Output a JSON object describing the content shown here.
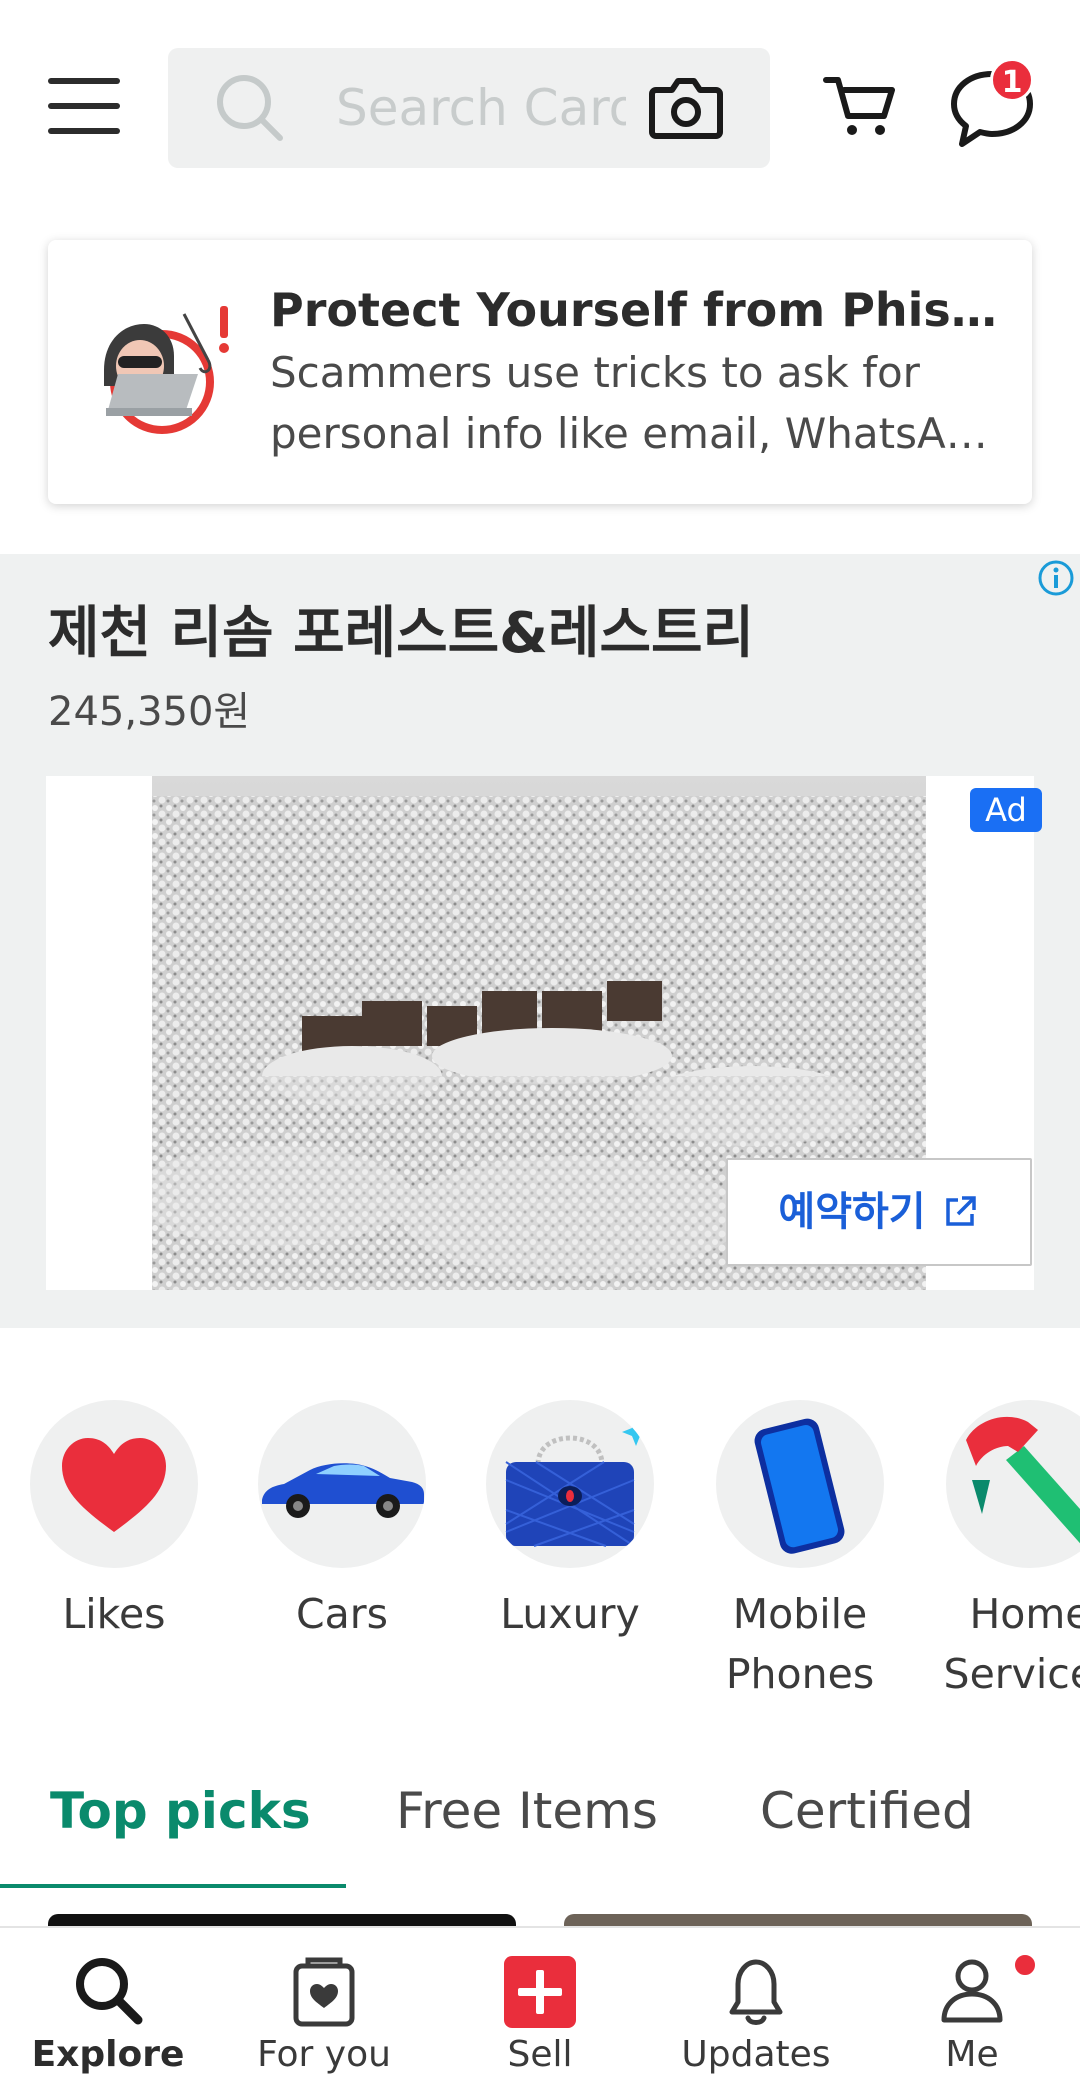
{
  "header": {
    "search_placeholder": "Search Carousell",
    "chat_badge_count": "1"
  },
  "phishing_card": {
    "title": "Protect Yourself from Phishing",
    "body": "Scammers use tricks to ask for personal info like email, WhatsApp number and more"
  },
  "ad": {
    "title": "제천 리솜 포레스트&레스트리",
    "price": "245,350원",
    "badge": "Ad",
    "cta_label": "예약하기"
  },
  "categories": [
    {
      "label": "Likes",
      "icon": "heart-icon"
    },
    {
      "label": "Cars",
      "icon": "car-icon"
    },
    {
      "label": "Luxury",
      "icon": "handbag-icon"
    },
    {
      "label": "Mobile Phones ...",
      "icon": "mobile-phone-icon"
    },
    {
      "label": "Home Services",
      "icon": "hammer-icon"
    }
  ],
  "tabs": [
    {
      "label": "Top picks",
      "active": true
    },
    {
      "label": "Free Items",
      "active": false
    },
    {
      "label": "Certified",
      "active": false
    }
  ],
  "bottom_nav": [
    {
      "label": "Explore",
      "icon": "search-icon",
      "active": true
    },
    {
      "label": "For you",
      "icon": "heart-bag-icon",
      "active": false
    },
    {
      "label": "Sell",
      "icon": "plus-square-icon",
      "active": false
    },
    {
      "label": "Updates",
      "icon": "bell-icon",
      "active": false
    },
    {
      "label": "Me",
      "icon": "profile-icon",
      "active": false
    }
  ],
  "colors": {
    "brand_green": "#0a8a6c",
    "accent_red": "#ea2e3c",
    "link_blue": "#1a5fd8",
    "ad_badge_blue": "#1a6ff4"
  }
}
